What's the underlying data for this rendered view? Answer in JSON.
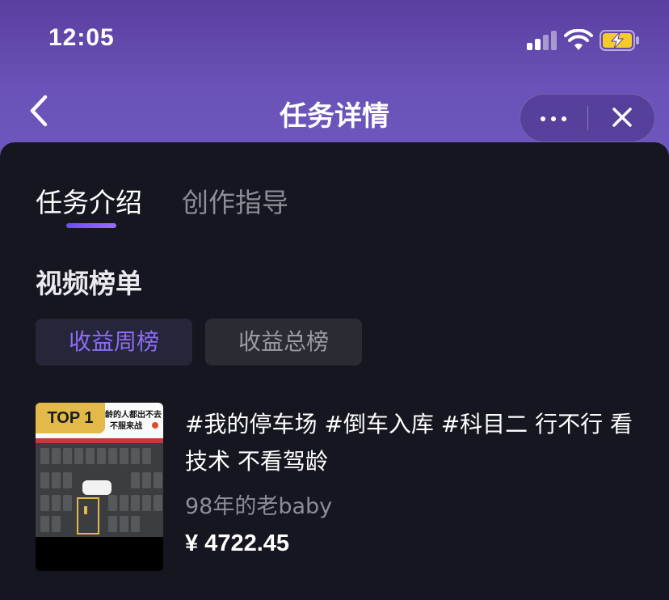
{
  "status_bar": {
    "time": "12:05",
    "battery_color": "#f5cc27"
  },
  "nav": {
    "title": "任务详情",
    "back_icon": "chevron-left-icon",
    "more_icon": "more-dots-icon",
    "close_icon": "close-icon"
  },
  "tabs": [
    {
      "label": "任务介绍",
      "active": true
    },
    {
      "label": "创作指导",
      "active": false
    }
  ],
  "section_title": "视频榜单",
  "filters": [
    {
      "label": "收益周榜",
      "active": true
    },
    {
      "label": "收益总榜",
      "active": false
    }
  ],
  "videos": [
    {
      "rank_badge": "TOP 1",
      "thumb_caption_1": "龄的人都出不去",
      "thumb_caption_2": "不服来战",
      "title": "#我的停车场 #倒车入库 #科目二 行不行 看技术 不看驾龄",
      "author": "98年的老baby",
      "earnings": "¥ 4722.45"
    }
  ],
  "colors": {
    "accent": "#8f6cf5",
    "header_top": "#5a3fa0",
    "header_bottom": "#6d58bd",
    "background": "#15161f",
    "badge": "#e3b94a"
  }
}
